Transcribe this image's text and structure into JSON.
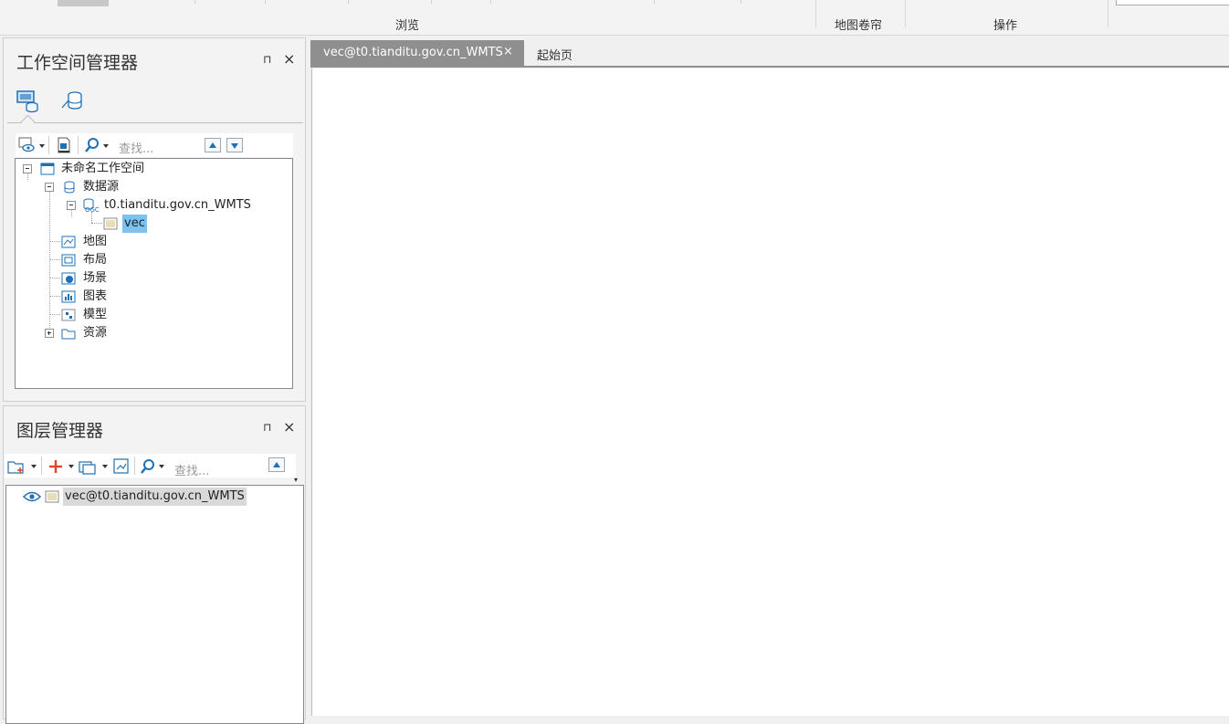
{
  "ribbon": {
    "groups": [
      "浏览",
      "地图卷帘",
      "操作"
    ]
  },
  "workspace_manager": {
    "title": "工作空间管理器",
    "pin_glyph": "⊓",
    "close_glyph": "×",
    "find_placeholder": "查找...",
    "tree": {
      "root": "未命名工作空间",
      "datasources": "数据源",
      "datasource_name": "t0.tianditu.gov.cn_WMTS",
      "dataset": "vec",
      "items": [
        "地图",
        "布局",
        "场景",
        "图表",
        "模型",
        "资源"
      ]
    }
  },
  "layer_manager": {
    "title": "图层管理器",
    "pin_glyph": "⊓",
    "close_glyph": "×",
    "find_placeholder": "查找...",
    "layers": [
      "vec@t0.tianditu.gov.cn_WMTS"
    ]
  },
  "document": {
    "tabs": [
      {
        "label": "vec@t0.tianditu.gov.cn_WMTS",
        "active": true
      },
      {
        "label": "起始页",
        "active": false
      }
    ],
    "close_glyph": "×"
  },
  "colors": {
    "selection": "#7ec0ee",
    "active_tab": "#8f8f8f",
    "accent_red": "#e0452a",
    "icon_blue": "#1f6fb5"
  },
  "icons": [
    "workspace-tab-icon",
    "datasource-tab-icon",
    "visibility-icon",
    "properties-icon",
    "search-icon",
    "up-arrow-icon",
    "down-arrow-icon",
    "workspace-icon",
    "datasource-icon",
    "ogc-service-icon",
    "image-dataset-icon",
    "map-icon",
    "layout-icon",
    "scene-icon",
    "chart-icon",
    "model-icon",
    "folder-icon",
    "new-map-icon",
    "add-icon",
    "layer-copy-icon",
    "full-extent-icon",
    "eye-icon"
  ]
}
